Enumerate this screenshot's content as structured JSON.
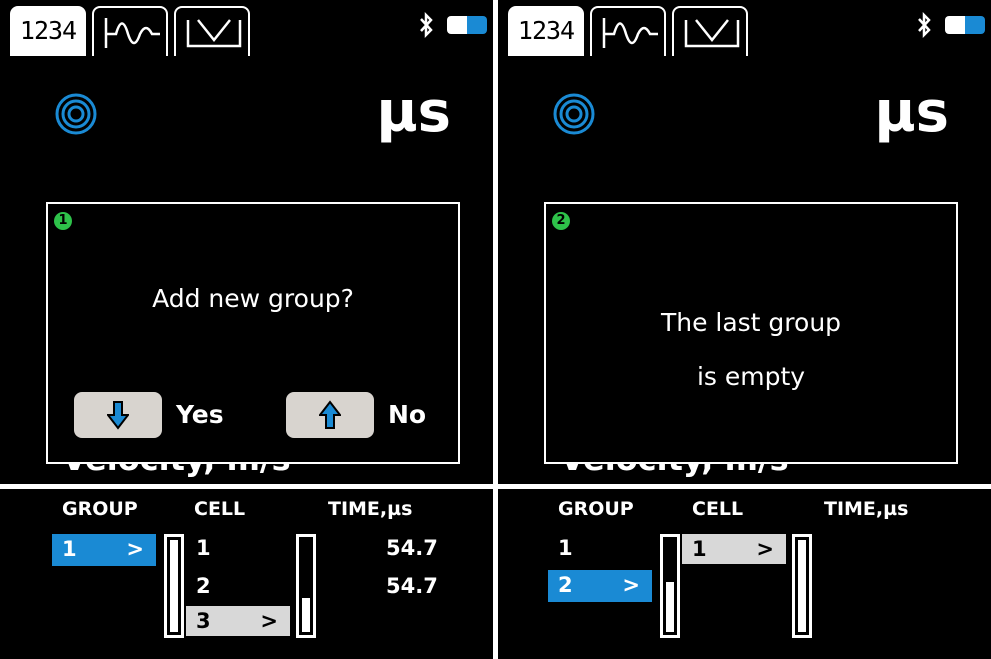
{
  "screens": [
    {
      "tabs": [
        {
          "label": "1234",
          "active": true
        },
        {
          "icon": "waveform-icon"
        },
        {
          "icon": "square-pulse-icon"
        }
      ],
      "unit": "µs",
      "velocity_label": "Velocity, m/s",
      "dialog": {
        "step": "1",
        "message": "Add new group?",
        "yes_label": "Yes",
        "no_label": "No"
      },
      "table": {
        "headers": {
          "group": "GROUP",
          "cell": "CELL",
          "time": "TIME,µs"
        },
        "groups": [
          {
            "label": "1",
            "selected": true
          }
        ],
        "cells": [
          {
            "label": "1",
            "time": "54.7"
          },
          {
            "label": "2",
            "time": "54.7"
          },
          {
            "label": "3",
            "selected": true
          }
        ]
      }
    },
    {
      "tabs": [
        {
          "label": "1234",
          "active": true
        },
        {
          "icon": "waveform-icon"
        },
        {
          "icon": "square-pulse-icon"
        }
      ],
      "unit": "µs",
      "velocity_label": "Velocity, m/s",
      "dialog": {
        "step": "2",
        "message_line1": "The last group",
        "message_line2": "is empty"
      },
      "table": {
        "headers": {
          "group": "GROUP",
          "cell": "CELL",
          "time": "TIME,µs"
        },
        "groups": [
          {
            "label": "1"
          },
          {
            "label": "2",
            "selected": true
          }
        ],
        "cells": [
          {
            "label": "1",
            "selected": true
          }
        ]
      }
    }
  ],
  "colors": {
    "accent": "#1a8ad4",
    "badge": "#2ec24a",
    "key": "#d8d4cf"
  }
}
